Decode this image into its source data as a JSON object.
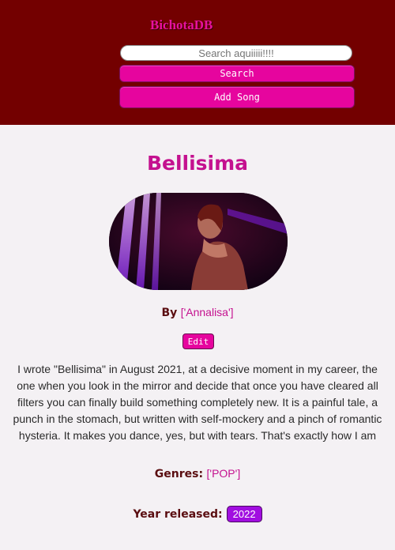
{
  "header": {
    "brand": "BichotaDB",
    "search_placeholder": "Search aquiiiii!!!!",
    "search_button": "Search",
    "add_button": "Add Song"
  },
  "song": {
    "title": "Bellisima",
    "by_label": "By",
    "artist": "['Annalisa']",
    "edit_button": "Edit",
    "description": "I wrote \"Bellisima\" in August 2021, at a decisive moment in my career, the one when you look in the mirror and decide that once you have cleared all filters you can finally build something completely new. It is a painful tale, a punch in the stomach, but written with self-mockery and a pinch of romantic hysteria. It makes you dance, yes, but with tears. That's exactly how I am",
    "genres_label": "Genres:",
    "genres_value": "['POP']",
    "year_label": "Year released:",
    "year_value": "2022"
  },
  "colors": {
    "header_bg": "#730000",
    "accent_pink": "#e6059e",
    "title_magenta": "#c4118f",
    "year_badge": "#a10ee0"
  }
}
